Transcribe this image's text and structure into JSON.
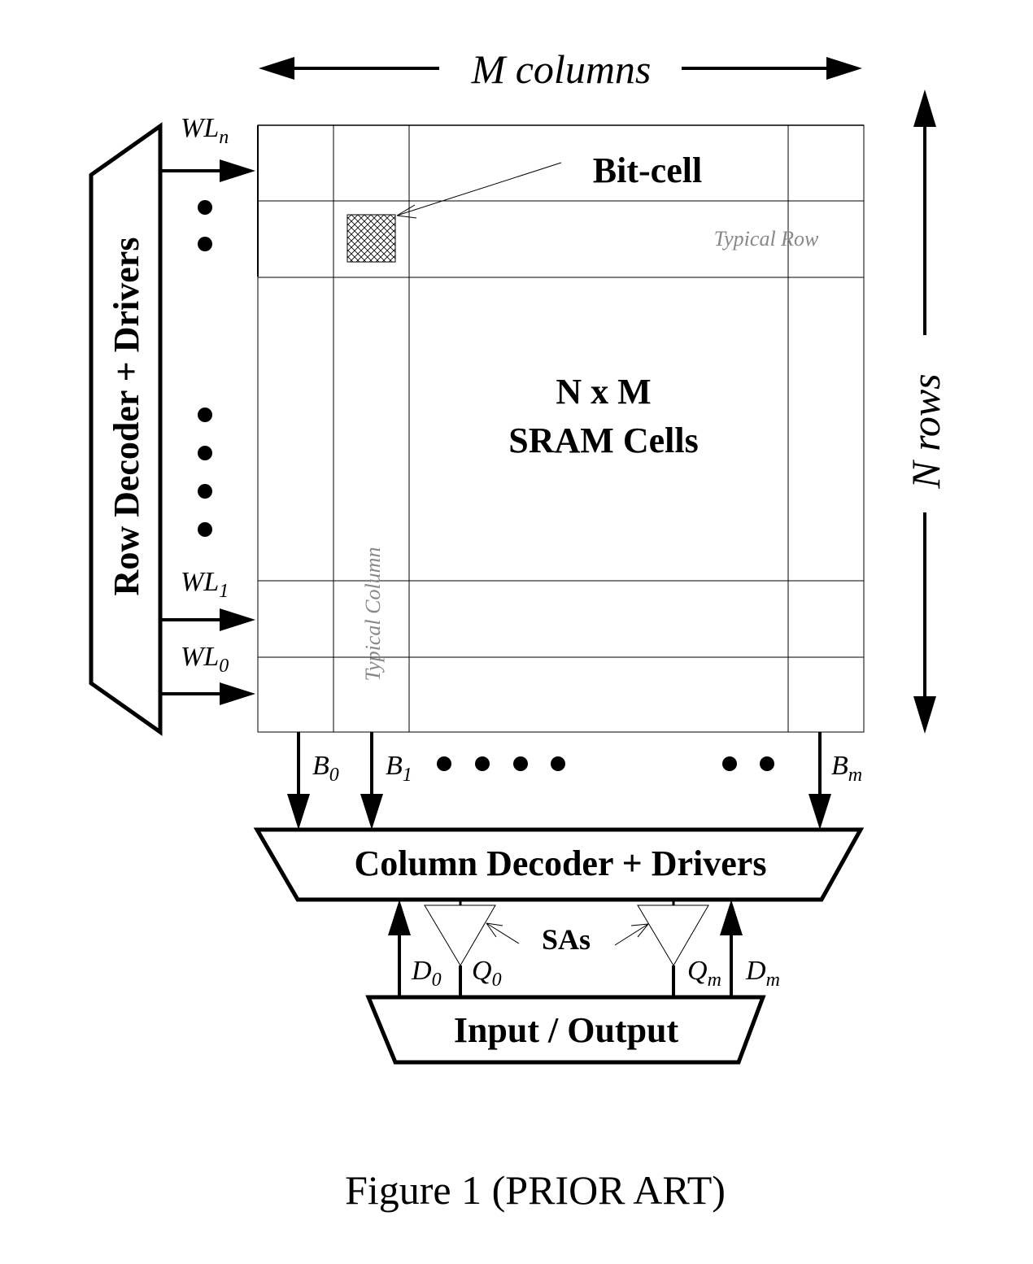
{
  "figure": {
    "caption": "Figure 1 (PRIOR ART)",
    "columns_label": "M columns",
    "rows_label": "N rows",
    "array_label_line1": "N x M",
    "array_label_line2": "SRAM Cells",
    "bitcell_label": "Bit-cell",
    "typical_row_label": "Typical Row",
    "typical_column_label": "Typical Column",
    "row_decoder_label": "Row Decoder + Drivers",
    "column_decoder_label": "Column Decoder + Drivers",
    "io_label": "Input / Output",
    "sa_label": "SAs",
    "wordlines": [
      {
        "base": "WL",
        "sub": "n"
      },
      {
        "base": "WL",
        "sub": "1"
      },
      {
        "base": "WL",
        "sub": "0"
      }
    ],
    "bitlines": [
      {
        "base": "B",
        "sub": "0"
      },
      {
        "base": "B",
        "sub": "1"
      },
      {
        "base": "B",
        "sub": "m"
      }
    ],
    "data_in": [
      {
        "base": "D",
        "sub": "0"
      },
      {
        "base": "D",
        "sub": "m"
      }
    ],
    "data_out": [
      {
        "base": "Q",
        "sub": "0"
      },
      {
        "base": "Q",
        "sub": "m"
      }
    ]
  }
}
